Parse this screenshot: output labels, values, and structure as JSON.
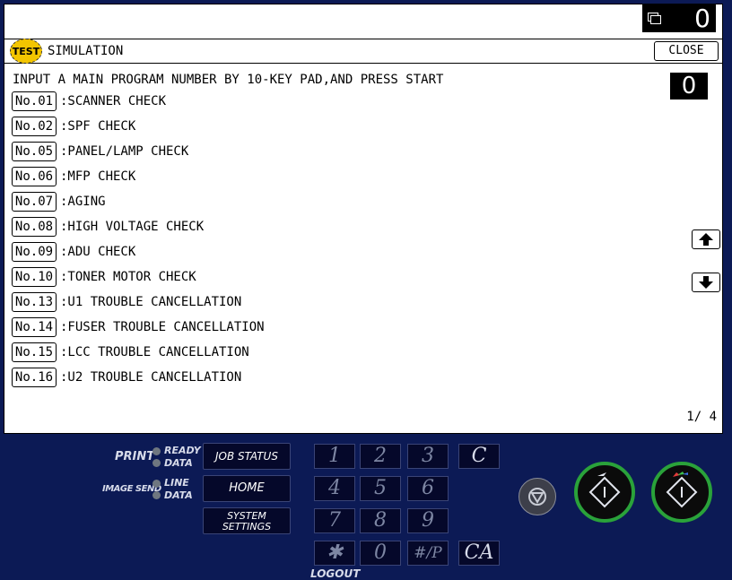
{
  "counter": {
    "value": "0"
  },
  "header": {
    "badge": "TEST",
    "title": "SIMULATION",
    "close_label": "CLOSE"
  },
  "instruction": "INPUT A MAIN PROGRAM NUMBER BY 10-KEY PAD,AND PRESS START",
  "entry_value": "0",
  "programs": [
    {
      "num": "No.01",
      "label": ":SCANNER CHECK"
    },
    {
      "num": "No.02",
      "label": ":SPF CHECK"
    },
    {
      "num": "No.05",
      "label": ":PANEL/LAMP CHECK"
    },
    {
      "num": "No.06",
      "label": ":MFP CHECK"
    },
    {
      "num": "No.07",
      "label": ":AGING"
    },
    {
      "num": "No.08",
      "label": ":HIGH VOLTAGE CHECK"
    },
    {
      "num": "No.09",
      "label": ":ADU CHECK"
    },
    {
      "num": "No.10",
      "label": ":TONER MOTOR CHECK"
    },
    {
      "num": "No.13",
      "label": ":U1 TROUBLE CANCELLATION"
    },
    {
      "num": "No.14",
      "label": ":FUSER TROUBLE CANCELLATION"
    },
    {
      "num": "No.15",
      "label": ":LCC TROUBLE CANCELLATION"
    },
    {
      "num": "No.16",
      "label": ":U2 TROUBLE CANCELLATION"
    }
  ],
  "pagination": "1/ 4",
  "icons": {
    "scroll_up": "arrow-up-icon",
    "scroll_down": "arrow-down-icon",
    "counter": "copy-icon"
  },
  "panel": {
    "print_label": "PRINT",
    "ready_label": "READY",
    "data_label": "DATA",
    "image_send_label": "IMAGE SEND",
    "line_label": "LINE",
    "data2_label": "DATA",
    "job_status": "JOB STATUS",
    "home": "HOME",
    "system_settings_line1": "SYSTEM",
    "system_settings_line2": "SETTINGS",
    "keys": [
      "1",
      "2",
      "3",
      "4",
      "5",
      "6",
      "7",
      "8",
      "9",
      "✱",
      "0",
      "#/P"
    ],
    "clear": "C",
    "clear_all": "CA",
    "logout": "LOGOUT"
  },
  "colors": {
    "panel_bg": "#0c1a55",
    "start_ring": "#2aa23a",
    "badge": "#f3c500"
  }
}
